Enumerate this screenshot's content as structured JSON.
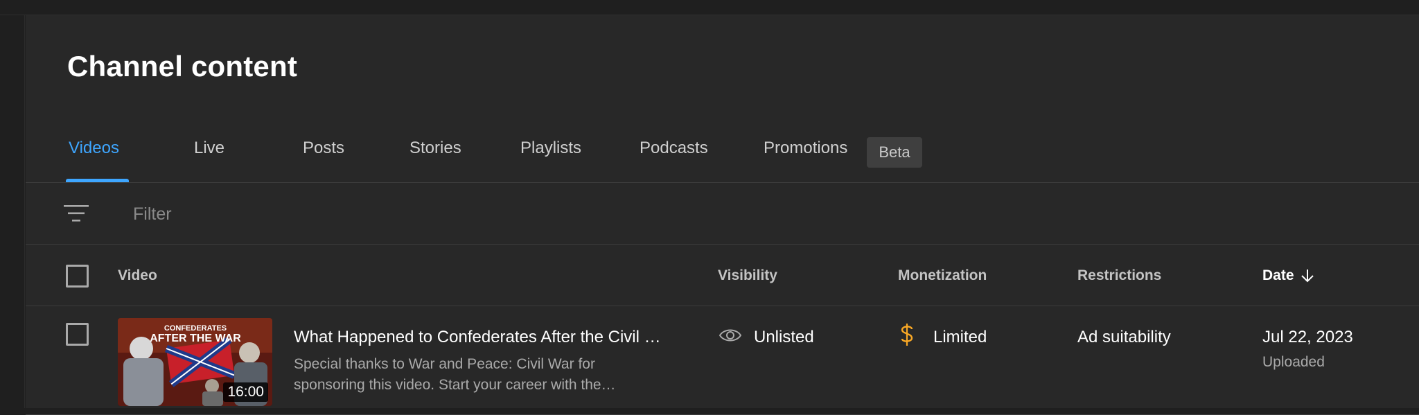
{
  "page": {
    "title": "Channel content"
  },
  "tabs": [
    {
      "label": "Videos"
    },
    {
      "label": "Live"
    },
    {
      "label": "Posts"
    },
    {
      "label": "Stories"
    },
    {
      "label": "Playlists"
    },
    {
      "label": "Podcasts"
    },
    {
      "label": "Promotions"
    }
  ],
  "badges": {
    "promotions": "Beta"
  },
  "filter": {
    "placeholder": "Filter",
    "value": ""
  },
  "table": {
    "columns": {
      "video": "Video",
      "visibility": "Visibility",
      "monetization": "Monetization",
      "restrictions": "Restrictions",
      "date": "Date"
    },
    "rows": [
      {
        "title": "What Happened to Confederates After the Civil War",
        "description": "Special thanks to War and Peace: Civil War for sponsoring this video. Start your career with the…",
        "duration": "16:00",
        "thumbnail_text_top": "CONFEDERATES",
        "thumbnail_text_main": "AFTER THE WAR",
        "visibility": "Unlisted",
        "visibility_icon": "eye-icon",
        "monetization": "Limited",
        "monetization_icon": "dollar-icon",
        "monetization_color": "#f9a825",
        "restrictions": "Ad suitability",
        "date": "Jul 22, 2023",
        "date_status": "Uploaded"
      }
    ]
  },
  "colors": {
    "accent": "#3ea6ff",
    "background": "#282828",
    "text_secondary": "#aaaaaa"
  }
}
